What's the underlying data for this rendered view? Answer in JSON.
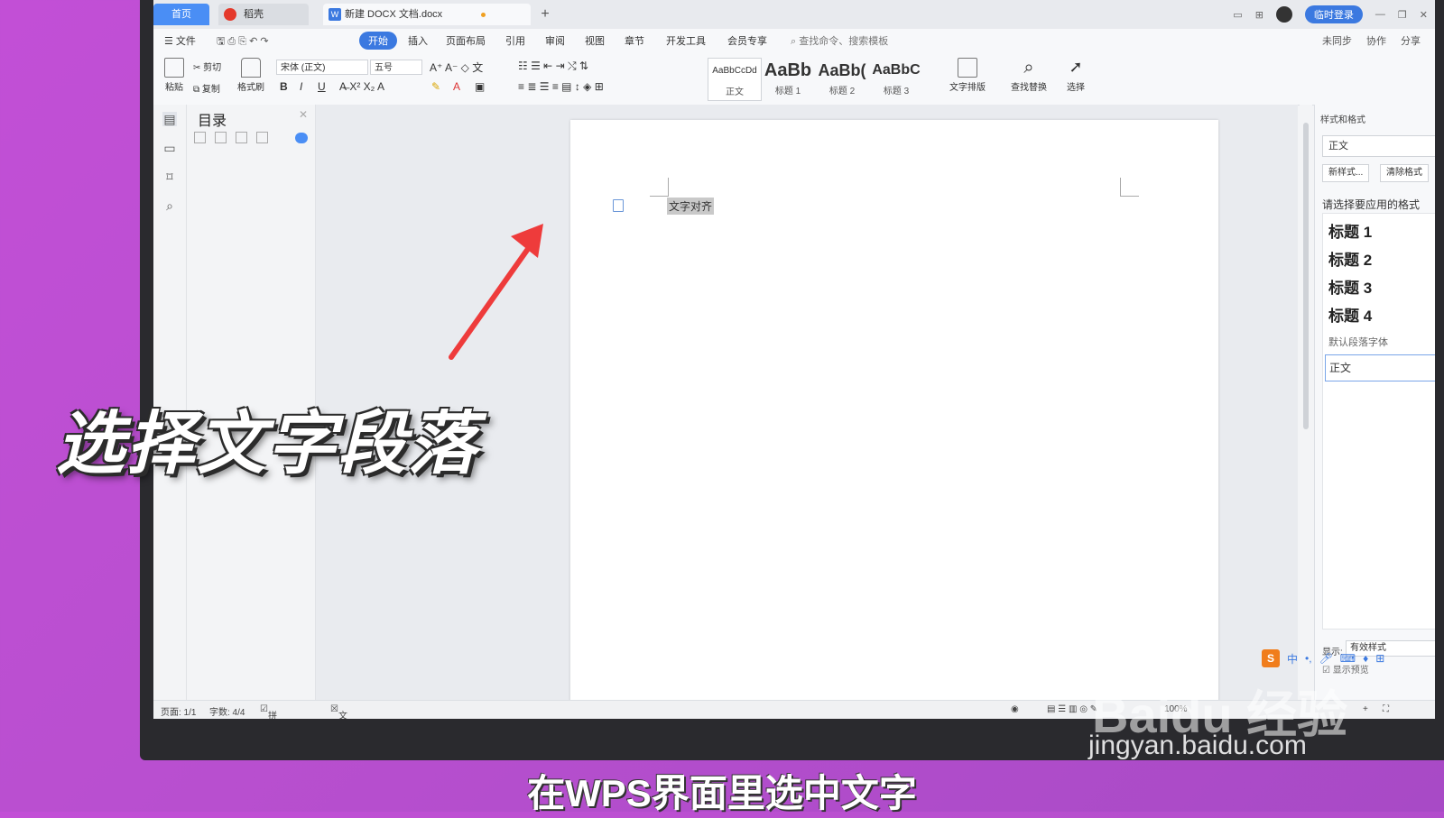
{
  "tabs": {
    "home": "首页",
    "daoke": "稻壳",
    "doc": "新建 DOCX 文档.docx",
    "add": "+"
  },
  "window": {
    "login": "临时登录"
  },
  "menu": {
    "file": "文件",
    "items": [
      "开始",
      "插入",
      "页面布局",
      "引用",
      "审阅",
      "视图",
      "章节",
      "开发工具",
      "会员专享"
    ],
    "search_placeholder": "查找命令、搜索模板",
    "right": [
      "未同步",
      "协作",
      "分享"
    ]
  },
  "ribbon": {
    "paste": "粘贴",
    "cut": "剪切",
    "copy": "复制",
    "format_painter": "格式刷",
    "font_name": "宋体 (正文)",
    "font_size": "五号",
    "styles": [
      {
        "preview": "AaBbCcDd",
        "label": "正文"
      },
      {
        "preview": "AaBb",
        "label": "标题 1"
      },
      {
        "preview": "AaBb(",
        "label": "标题 2"
      },
      {
        "preview": "AaBbC",
        "label": "标题 3"
      }
    ],
    "text_layout": "文字排版",
    "find_replace": "查找替换",
    "select": "选择"
  },
  "navpane": {
    "title": "目录"
  },
  "document": {
    "selected_text": "文字对齐"
  },
  "style_panel": {
    "title": "样式和格式",
    "current_style": "正文",
    "new_style": "新样式...",
    "clear_format": "清除格式",
    "apply_label": "请选择要应用的格式",
    "headings": [
      "标题 1",
      "标题 2",
      "标题 3",
      "标题 4"
    ],
    "default_font": "默认段落字体",
    "body": "正文",
    "show_label": "显示:",
    "show_value": "有效样式",
    "preview_label": "显示预览"
  },
  "ime": {
    "lang": "中"
  },
  "statusbar": {
    "page": "页面: 1/1",
    "words": "字数: 4/4",
    "spell": "拼写检查",
    "proof": "文档校对",
    "zoom": "100%"
  },
  "overlay": {
    "title": "选择文字段落",
    "subtitle": "在WPS界面里选中文字"
  },
  "watermark": {
    "brand": "Baidu 经验",
    "url": "jingyan.baidu.com"
  },
  "colors": {
    "accent": "#3b79e0",
    "background": "#b84fcf",
    "arrow": "#ee3b3b"
  }
}
